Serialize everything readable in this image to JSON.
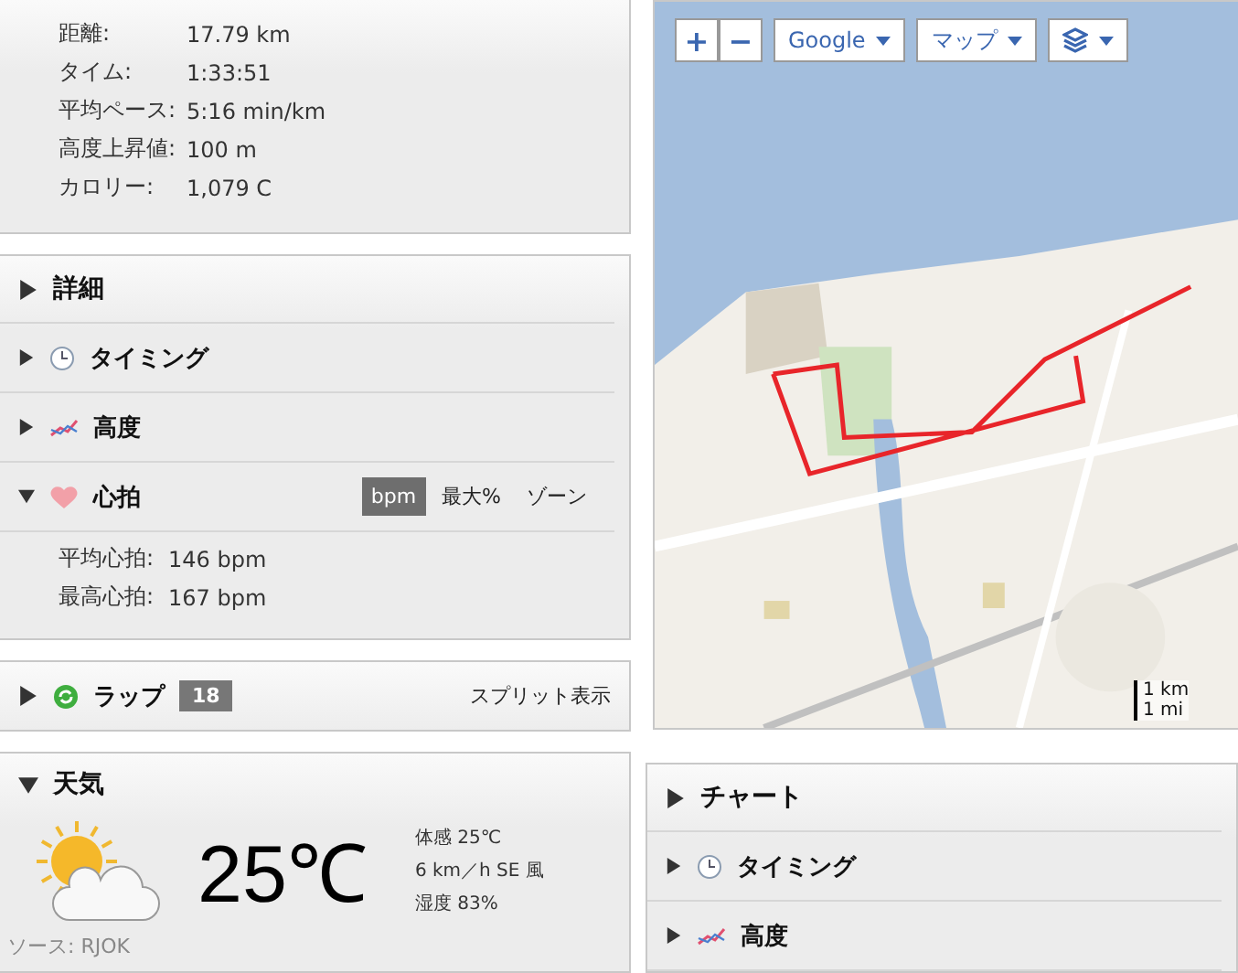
{
  "summary": {
    "stats": [
      {
        "label": "距離:",
        "value": "17.79 km"
      },
      {
        "label": "タイム:",
        "value": "1:33:51"
      },
      {
        "label": "平均ペース:",
        "value": "5:16 min/km"
      },
      {
        "label": "高度上昇値:",
        "value": "100 m"
      },
      {
        "label": "カロリー:",
        "value": "1,079 C"
      }
    ]
  },
  "details": {
    "title": "詳細",
    "expanded": false,
    "sections": [
      {
        "title": "タイミング",
        "kind": "timing",
        "expanded": false
      },
      {
        "title": "高度",
        "kind": "elevation",
        "expanded": false
      },
      {
        "title": "心拍",
        "kind": "heart",
        "expanded": true,
        "units": [
          {
            "label": "bpm",
            "selected": true
          },
          {
            "label": "最大%",
            "selected": false
          },
          {
            "label": "ゾーン",
            "selected": false
          }
        ],
        "stats": [
          {
            "label": "平均心拍:",
            "value": "146 bpm"
          },
          {
            "label": "最高心拍:",
            "value": "167 bpm"
          }
        ]
      }
    ]
  },
  "laps": {
    "title": "ラップ",
    "count": "18",
    "expanded": false,
    "action": "スプリット表示"
  },
  "weather": {
    "title": "天気",
    "expanded": true,
    "temperature": "25℃",
    "details": [
      "体感 25℃",
      "6 km／h SE 風",
      "湿度 83%"
    ],
    "source": "ソース: RJOK"
  },
  "map": {
    "controls": [
      {
        "label": "+",
        "kind": "zoom"
      },
      {
        "label": "−",
        "kind": "zoom"
      },
      {
        "label": "Google",
        "kind": "menu"
      },
      {
        "label": "マップ",
        "kind": "menu"
      },
      {
        "kind": "layers"
      }
    ],
    "scale": [
      "1 km",
      "1 mi"
    ]
  },
  "chart_panel": {
    "title": "チャート",
    "expanded": false,
    "sections": [
      {
        "title": "タイミング",
        "kind": "timing",
        "expanded": false
      },
      {
        "title": "高度",
        "kind": "elevation",
        "expanded": false
      }
    ]
  }
}
